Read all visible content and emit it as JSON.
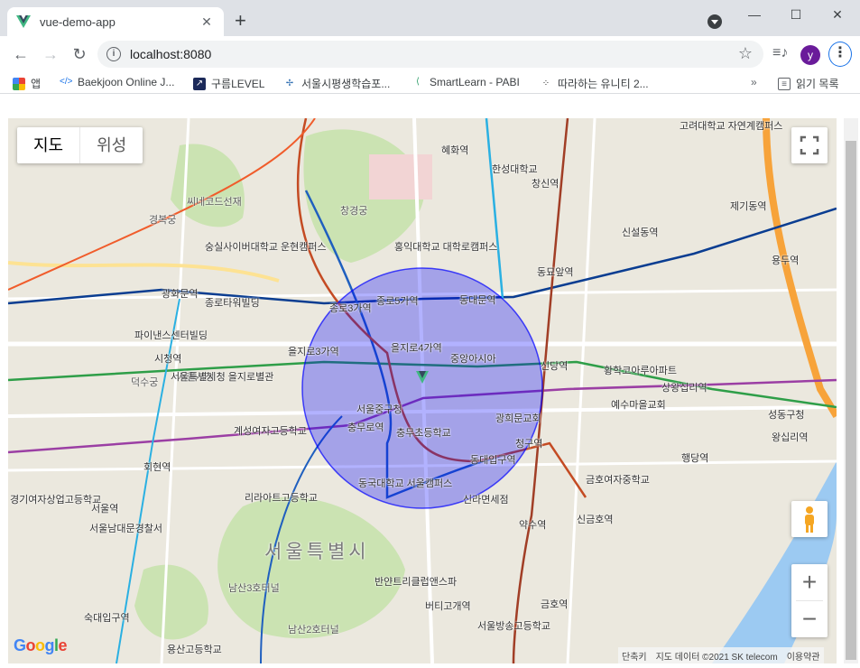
{
  "browser": {
    "tab_title": "vue-demo-app",
    "url": "localhost:8080",
    "profile_initial": "y"
  },
  "bookmarks": [
    {
      "label": "앱",
      "icon": "apps-grid-icon"
    },
    {
      "label": "Baekjoon Online J...",
      "icon": "code-icon"
    },
    {
      "label": "구름LEVEL",
      "icon": "arrow-icon"
    },
    {
      "label": "서울시평생학습포...",
      "icon": "bird-icon"
    },
    {
      "label": "SmartLearn - PABI",
      "icon": "leaf-icon"
    },
    {
      "label": "따라하는 유니티 2...",
      "icon": "dots-icon"
    },
    {
      "label": "읽기 목록",
      "icon": "reading-list-icon"
    }
  ],
  "map": {
    "type_options": [
      "지도",
      "위성"
    ],
    "selected_type": "지도",
    "attribution": {
      "shortcuts": "단축키",
      "data": "지도 데이터 ©2021 SK telecom",
      "terms": "이용약관"
    },
    "logo": "Google",
    "zoom_in": "+",
    "zoom_out": "−",
    "circle_color": "#0000ff",
    "labels": [
      {
        "text": "서울특별시",
        "style": "big"
      },
      {
        "text": "을지로4가역"
      },
      {
        "text": "종로5가역"
      },
      {
        "text": "동대문역"
      },
      {
        "text": "신당역"
      },
      {
        "text": "청구역"
      },
      {
        "text": "약수역"
      },
      {
        "text": "동대입구역"
      },
      {
        "text": "충무로역"
      },
      {
        "text": "을지로3가역"
      },
      {
        "text": "종로3가역"
      },
      {
        "text": "광화문역"
      },
      {
        "text": "시청역"
      },
      {
        "text": "회현역"
      },
      {
        "text": "서울역"
      },
      {
        "text": "혜화역"
      },
      {
        "text": "창신역"
      },
      {
        "text": "동묘앞역"
      },
      {
        "text": "신설동역"
      },
      {
        "text": "용두역"
      },
      {
        "text": "제기동역"
      },
      {
        "text": "상왕십리역"
      },
      {
        "text": "왕십리역"
      },
      {
        "text": "행당역"
      },
      {
        "text": "신금호역"
      },
      {
        "text": "금호역"
      },
      {
        "text": "버티고개역"
      },
      {
        "text": "숙대입구역"
      },
      {
        "text": "경복궁"
      },
      {
        "text": "창경궁"
      },
      {
        "text": "덕수궁"
      },
      {
        "text": "서울중구청"
      },
      {
        "text": "동국대학교 서울캠퍼스"
      },
      {
        "text": "광희문교회"
      },
      {
        "text": "황학코아루아파트"
      },
      {
        "text": "남산3호터널"
      },
      {
        "text": "남산2호터널"
      },
      {
        "text": "반얀트리클럽앤스파"
      },
      {
        "text": "리라아트고등학교"
      },
      {
        "text": "계성여자고등학교"
      },
      {
        "text": "종로타워빌딩"
      },
      {
        "text": "파이낸스센터빌딩"
      },
      {
        "text": "서울시청"
      },
      {
        "text": "중앙아시아"
      },
      {
        "text": "예수마을교회"
      },
      {
        "text": "금호여자중학교"
      },
      {
        "text": "성동구청"
      },
      {
        "text": "한성대학교"
      },
      {
        "text": "고려대학교 자연계캠퍼스"
      },
      {
        "text": "서울방송고등학교"
      },
      {
        "text": "용산고등학교"
      },
      {
        "text": "경기여자상업고등학교"
      },
      {
        "text": "서울남대문경찰서"
      },
      {
        "text": "씨네코드선재"
      },
      {
        "text": "숭실사이버대학교 운현캠퍼스"
      },
      {
        "text": "홍익대학교 대학로캠퍼스"
      },
      {
        "text": "신라면세점"
      },
      {
        "text": "충무초등학교"
      },
      {
        "text": "서울특별시청 을지로별관"
      }
    ]
  }
}
